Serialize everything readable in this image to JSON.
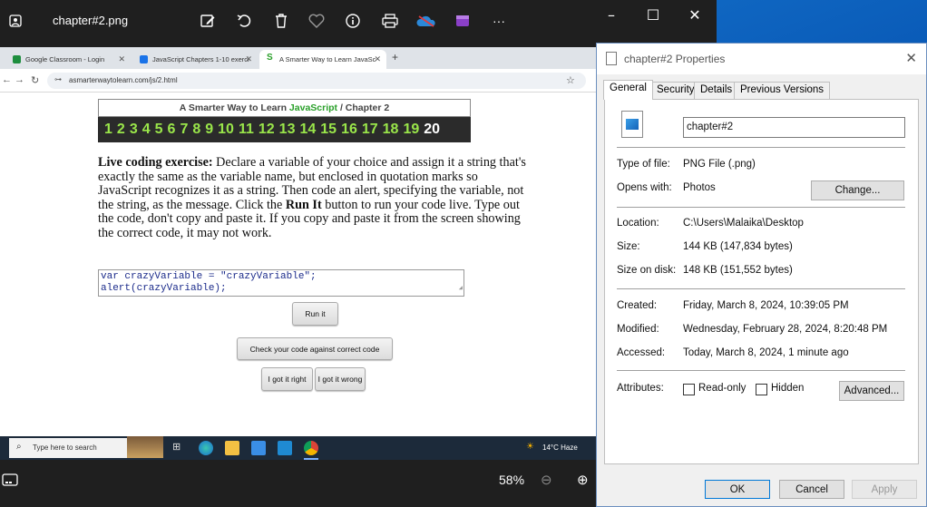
{
  "photos": {
    "title": "chapter#2.png",
    "zoom": "58%",
    "toolbar_icons": [
      "edit-icon",
      "rotate-icon",
      "delete-icon",
      "favorite-icon",
      "info-icon",
      "print-icon",
      "onedrive-icon",
      "clipchamp-icon",
      "more-icon"
    ],
    "more_label": "···"
  },
  "browser": {
    "tabs": [
      {
        "label": "Google Classroom - Login",
        "color": "#1e8e3e"
      },
      {
        "label": "JavaScript Chapters 1-10 exerci",
        "color": "#1a73e8"
      },
      {
        "label": "A Smarter Way to Learn JavaSc",
        "color": "#2aa02a"
      }
    ],
    "new_tab": "+",
    "url": "asmarterwaytolearn.com/js/2.html"
  },
  "page": {
    "header_prefix": "A Smarter Way to Learn ",
    "header_js": "JavaScript",
    "header_suffix": " / Chapter 2",
    "chapters": [
      "1",
      "2",
      "3",
      "4",
      "5",
      "6",
      "7",
      "8",
      "9",
      "10",
      "11",
      "12",
      "13",
      "14",
      "15",
      "16",
      "17",
      "18",
      "19",
      "20"
    ],
    "current_chapter": "20",
    "exercise_bold": "Live coding exercise:",
    "exercise_text1": " Declare a variable of your choice and assign it a string that's exactly the same as the variable name, but enclosed in quotation marks so JavaScript recognizes it as a string. Then code an alert, specifying the variable, not the string, as the message. Click the ",
    "exercise_runit": "Run It",
    "exercise_text2": " button to run your code live. Type out the code, don't copy and paste it. If you copy and paste it from the screen showing the correct code, it may not work.",
    "code_line1": "var crazyVariable = \"crazyVariable\";",
    "code_line2": "alert(crazyVariable);",
    "run_button": "Run it",
    "check_button": "Check your code against correct code",
    "right_button": "I got it right",
    "wrong_button": "I got it wrong"
  },
  "inner_taskbar": {
    "search_placeholder": "Type here to search",
    "weather": "14°C  Haze"
  },
  "properties": {
    "title": "chapter#2 Properties",
    "tabs": [
      "General",
      "Security",
      "Details",
      "Previous Versions"
    ],
    "name": "chapter#2",
    "type_label": "Type of file:",
    "type_value": "PNG File (.png)",
    "opens_label": "Opens with:",
    "opens_value": "Photos",
    "change_button": "Change...",
    "location_label": "Location:",
    "location_value": "C:\\Users\\Malaika\\Desktop",
    "size_label": "Size:",
    "size_value": "144 KB (147,834 bytes)",
    "disk_label": "Size on disk:",
    "disk_value": "148 KB (151,552 bytes)",
    "created_label": "Created:",
    "created_value": "Friday, March 8, 2024, 10:39:05 PM",
    "modified_label": "Modified:",
    "modified_value": "Wednesday, February 28, 2024, 8:20:48 PM",
    "accessed_label": "Accessed:",
    "accessed_value": "Today, March 8, 2024, 1 minute ago",
    "attributes_label": "Attributes:",
    "readonly_label": "Read-only",
    "hidden_label": "Hidden",
    "advanced_button": "Advanced...",
    "ok_button": "OK",
    "cancel_button": "Cancel",
    "apply_button": "Apply"
  }
}
